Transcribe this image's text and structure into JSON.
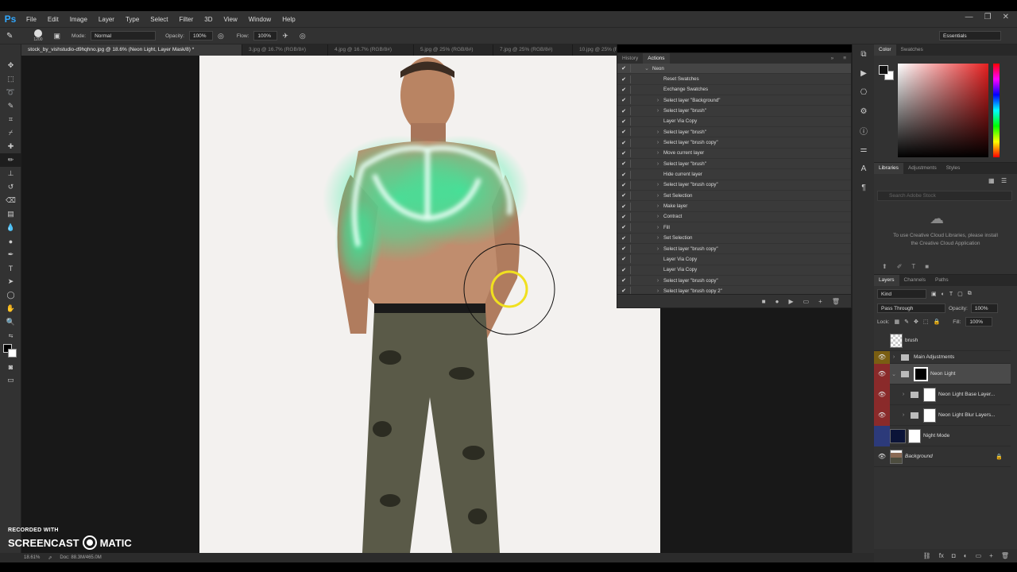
{
  "app": {
    "logo": "Ps"
  },
  "menu": [
    "File",
    "Edit",
    "Image",
    "Layer",
    "Type",
    "Select",
    "Filter",
    "3D",
    "View",
    "Window",
    "Help"
  ],
  "window_controls": [
    "—",
    "❐",
    "✕"
  ],
  "options": {
    "brush_size": "1200",
    "mode_label": "Mode:",
    "mode_value": "Normal",
    "opacity_label": "Opacity:",
    "opacity_value": "100%",
    "flow_label": "Flow:",
    "flow_value": "100%",
    "workspace": "Essentials"
  },
  "doc_tabs": [
    {
      "label": "stock_by_vishstudio-d9hqhno.jpg @ 18.6% (Neon Light, Layer Mask/8) *",
      "active": true
    },
    {
      "label": "3.jpg @ 16.7% (RGB/8#)",
      "active": false
    },
    {
      "label": "4.jpg @ 16.7% (RGB/8#)",
      "active": false
    },
    {
      "label": "5.jpg @ 25% (RGB/8#)",
      "active": false
    },
    {
      "label": "7.jpg @ 25% (RGB/8#)",
      "active": false
    },
    {
      "label": "10.jpg @ 25% (RGB/8#)",
      "active": false
    }
  ],
  "actions_panel": {
    "tabs": [
      "History",
      "Actions"
    ],
    "active_tab": "Actions",
    "set_name": "Neon",
    "items": [
      {
        "label": "Reset Swatches",
        "expandable": false
      },
      {
        "label": "Exchange Swatches",
        "expandable": false
      },
      {
        "label": "Select layer \"Background\"",
        "expandable": true
      },
      {
        "label": "Select layer \"brush\"",
        "expandable": true
      },
      {
        "label": "Layer Via Copy",
        "expandable": false
      },
      {
        "label": "Select layer \"brush\"",
        "expandable": true
      },
      {
        "label": "Select layer \"brush copy\"",
        "expandable": true
      },
      {
        "label": "Move current layer",
        "expandable": true
      },
      {
        "label": "Select layer \"brush\"",
        "expandable": true
      },
      {
        "label": "Hide current layer",
        "expandable": false
      },
      {
        "label": "Select layer \"brush copy\"",
        "expandable": true
      },
      {
        "label": "Set Selection",
        "expandable": true
      },
      {
        "label": "Make layer",
        "expandable": true
      },
      {
        "label": "Contract",
        "expandable": true
      },
      {
        "label": "Fill",
        "expandable": true
      },
      {
        "label": "Set Selection",
        "expandable": true
      },
      {
        "label": "Select layer \"brush copy\"",
        "expandable": true
      },
      {
        "label": "Layer Via Copy",
        "expandable": false
      },
      {
        "label": "Layer Via Copy",
        "expandable": false
      },
      {
        "label": "Select layer \"brush copy\"",
        "expandable": true
      },
      {
        "label": "Select layer \"brush copy 2\"",
        "expandable": true
      }
    ],
    "footer_icons": [
      "■",
      "●",
      "▶",
      "▭",
      "+",
      "🗑"
    ]
  },
  "color_panel": {
    "tabs": [
      "Color",
      "Swatches"
    ],
    "fg": "#111111",
    "bg": "#ffffff"
  },
  "libraries_panel": {
    "tabs": [
      "Libraries",
      "Adjustments",
      "Styles"
    ],
    "search_placeholder": "Search Adobe Stock",
    "message": "To use Creative Cloud Libraries, please install the Creative Cloud Application"
  },
  "layers_panel": {
    "tabs": [
      "Layers",
      "Channels",
      "Paths"
    ],
    "filter": "Kind",
    "blend_mode": "Pass Through",
    "opacity_label": "Opacity:",
    "opacity_value": "100%",
    "lock_label": "Lock:",
    "fill_label": "Fill:",
    "fill_value": "100%",
    "layers": [
      {
        "name": "brush",
        "eye": "none"
      },
      {
        "name": "Main Adjustments",
        "eye": "yellow"
      },
      {
        "name": "Neon Light",
        "eye": "red"
      },
      {
        "name": "Neon Light Base Layer...",
        "eye": "red"
      },
      {
        "name": "Neon Light Blur Layers...",
        "eye": "red"
      },
      {
        "name": "Night Mode",
        "eye": "blue"
      },
      {
        "name": "Background",
        "eye": "plain"
      }
    ]
  },
  "status": {
    "zoom": "18.61%",
    "doc": "Doc: 88.3M/465.0M"
  },
  "watermark": {
    "line1": "RECORDED WITH",
    "line2a": "SCREENCAST",
    "line2b": "MATIC"
  },
  "colors": {
    "neon": "#2ef0a0",
    "brush_ring": "#f0e020",
    "red_eye": "#8a2a2a",
    "accent": "#31a8ff"
  }
}
